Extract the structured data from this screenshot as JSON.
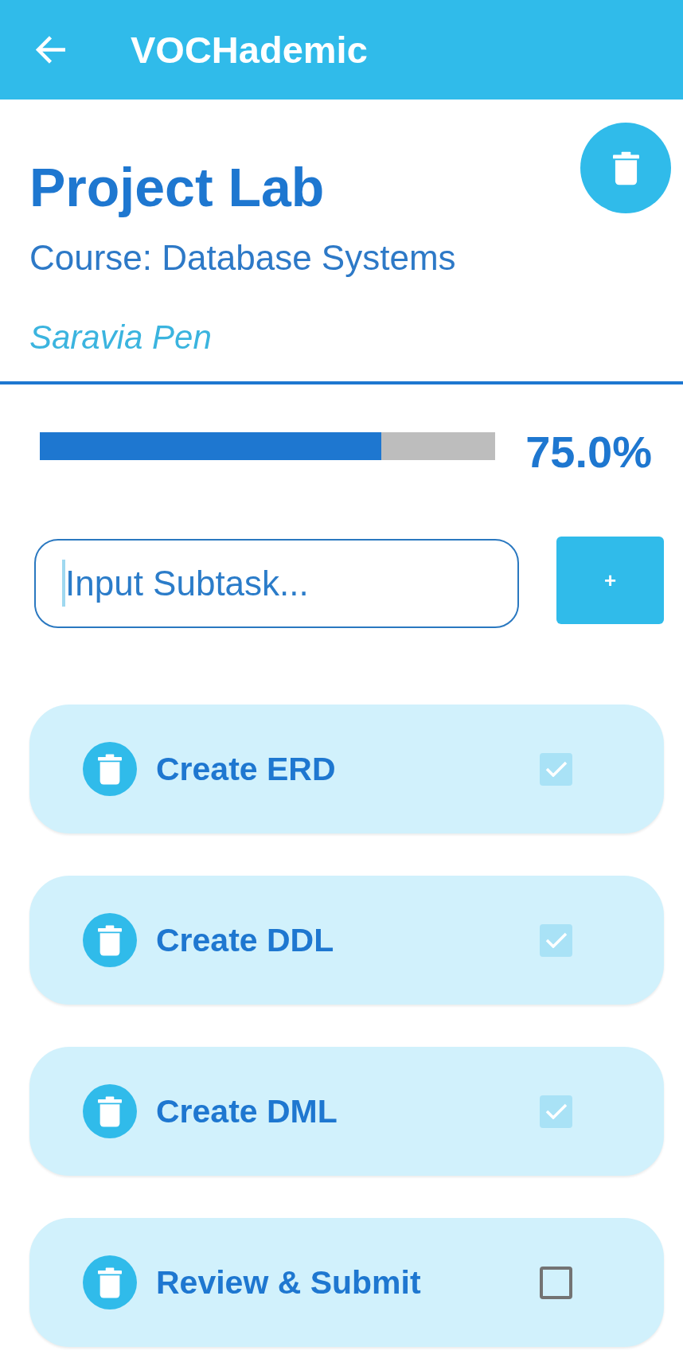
{
  "app_bar": {
    "title": "VOCHademic"
  },
  "project": {
    "title": "Project Lab",
    "course": "Course: Database Systems",
    "author": "Saravia Pen"
  },
  "progress": {
    "level": 0.75,
    "reading": "75.0%"
  },
  "new_subtask": {
    "placeholder": "Input Subtask...",
    "focused": true,
    "add_button": "+"
  },
  "subtasks": [
    {
      "label": "Create ERD",
      "checked": true
    },
    {
      "label": "Create DDL",
      "checked": true
    },
    {
      "label": "Create DML",
      "checked": true
    },
    {
      "label": "Review & Submit",
      "checked": false
    }
  ]
}
